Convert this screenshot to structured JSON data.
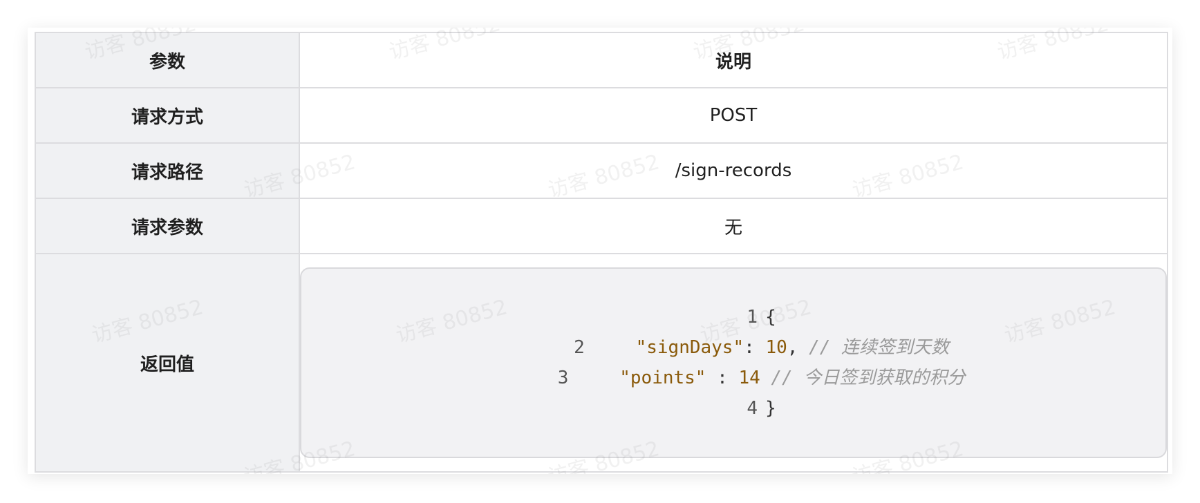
{
  "watermark": "访客 80852",
  "table": {
    "header": {
      "param": "参数",
      "desc": "说明"
    },
    "rows": [
      {
        "param": "请求方式",
        "value": "POST"
      },
      {
        "param": "请求路径",
        "value": "/sign-records"
      },
      {
        "param": "请求参数",
        "value": "无"
      }
    ],
    "return_row": {
      "param": "返回值"
    }
  },
  "code": {
    "lines": [
      {
        "n": "1",
        "text": "{"
      },
      {
        "n": "2",
        "key": "\"signDays\"",
        "sep": ": ",
        "val": "10",
        "after": ", ",
        "comment": "// 连续签到天数"
      },
      {
        "n": "3",
        "key": "\"points\"",
        "sep": " : ",
        "val": "14",
        "after": " ",
        "comment": "// 今日签到获取的积分"
      },
      {
        "n": "4",
        "text": "}"
      }
    ]
  },
  "colors": {
    "header_bg": "#f0f1f3",
    "border": "#dcdcdf",
    "code_string": "#8a5a0a",
    "code_comment": "#9a9a9a"
  }
}
